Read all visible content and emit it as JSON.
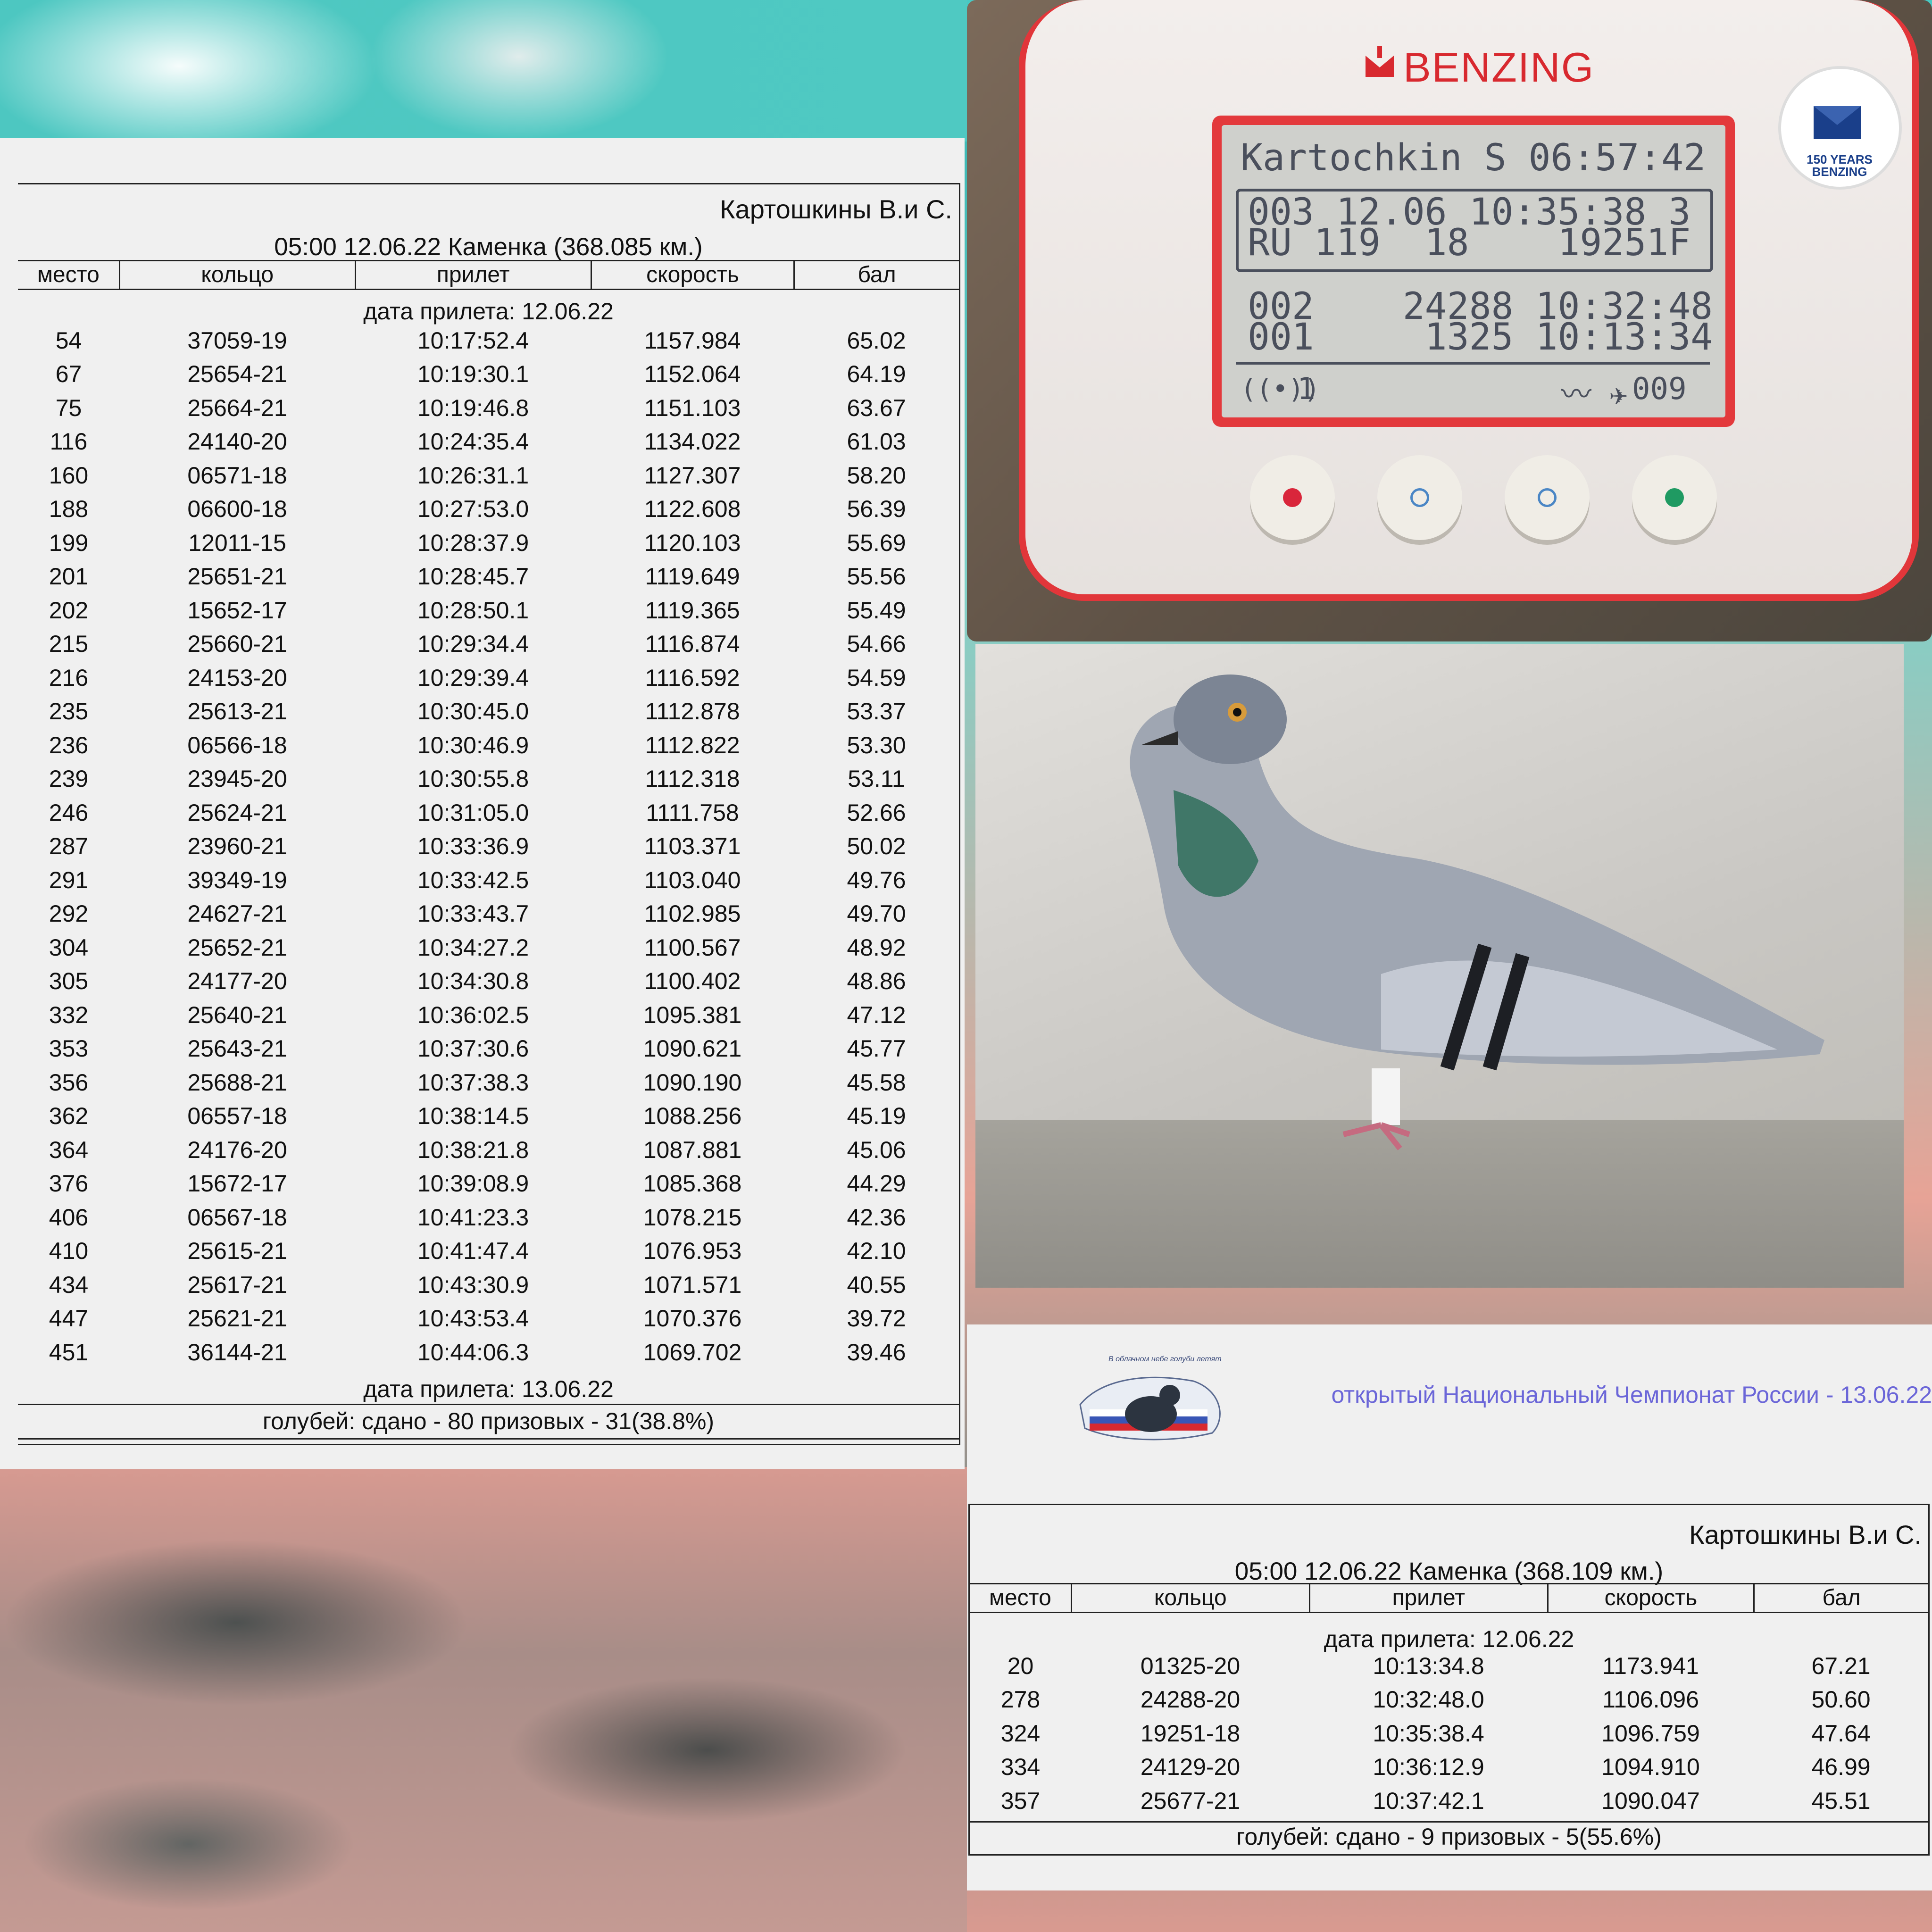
{
  "table_left": {
    "owner": "Картошкины В.и С.",
    "race": "05:00 12.06.22 Каменка (368.085 км.)",
    "headers": [
      "место",
      "кольцо",
      "прилет",
      "скорость",
      "бал"
    ],
    "date1": "дата прилета: 12.06.22",
    "rows": [
      [
        "54",
        "37059-19",
        "10:17:52.4",
        "1157.984",
        "65.02"
      ],
      [
        "67",
        "25654-21",
        "10:19:30.1",
        "1152.064",
        "64.19"
      ],
      [
        "75",
        "25664-21",
        "10:19:46.8",
        "1151.103",
        "63.67"
      ],
      [
        "116",
        "24140-20",
        "10:24:35.4",
        "1134.022",
        "61.03"
      ],
      [
        "160",
        "06571-18",
        "10:26:31.1",
        "1127.307",
        "58.20"
      ],
      [
        "188",
        "06600-18",
        "10:27:53.0",
        "1122.608",
        "56.39"
      ],
      [
        "199",
        "12011-15",
        "10:28:37.9",
        "1120.103",
        "55.69"
      ],
      [
        "201",
        "25651-21",
        "10:28:45.7",
        "1119.649",
        "55.56"
      ],
      [
        "202",
        "15652-17",
        "10:28:50.1",
        "1119.365",
        "55.49"
      ],
      [
        "215",
        "25660-21",
        "10:29:34.4",
        "1116.874",
        "54.66"
      ],
      [
        "216",
        "24153-20",
        "10:29:39.4",
        "1116.592",
        "54.59"
      ],
      [
        "235",
        "25613-21",
        "10:30:45.0",
        "1112.878",
        "53.37"
      ],
      [
        "236",
        "06566-18",
        "10:30:46.9",
        "1112.822",
        "53.30"
      ],
      [
        "239",
        "23945-20",
        "10:30:55.8",
        "1112.318",
        "53.11"
      ],
      [
        "246",
        "25624-21",
        "10:31:05.0",
        "1111.758",
        "52.66"
      ],
      [
        "287",
        "23960-21",
        "10:33:36.9",
        "1103.371",
        "50.02"
      ],
      [
        "291",
        "39349-19",
        "10:33:42.5",
        "1103.040",
        "49.76"
      ],
      [
        "292",
        "24627-21",
        "10:33:43.7",
        "1102.985",
        "49.70"
      ],
      [
        "304",
        "25652-21",
        "10:34:27.2",
        "1100.567",
        "48.92"
      ],
      [
        "305",
        "24177-20",
        "10:34:30.8",
        "1100.402",
        "48.86"
      ],
      [
        "332",
        "25640-21",
        "10:36:02.5",
        "1095.381",
        "47.12"
      ],
      [
        "353",
        "25643-21",
        "10:37:30.6",
        "1090.621",
        "45.77"
      ],
      [
        "356",
        "25688-21",
        "10:37:38.3",
        "1090.190",
        "45.58"
      ],
      [
        "362",
        "06557-18",
        "10:38:14.5",
        "1088.256",
        "45.19"
      ],
      [
        "364",
        "24176-20",
        "10:38:21.8",
        "1087.881",
        "45.06"
      ],
      [
        "376",
        "15672-17",
        "10:39:08.9",
        "1085.368",
        "44.29"
      ],
      [
        "406",
        "06567-18",
        "10:41:23.3",
        "1078.215",
        "42.36"
      ],
      [
        "410",
        "25615-21",
        "10:41:47.4",
        "1076.953",
        "42.10"
      ],
      [
        "434",
        "25617-21",
        "10:43:30.9",
        "1071.571",
        "40.55"
      ],
      [
        "447",
        "25621-21",
        "10:43:53.4",
        "1070.376",
        "39.72"
      ],
      [
        "451",
        "36144-21",
        "10:44:06.3",
        "1069.702",
        "39.46"
      ]
    ],
    "date2": "дата прилета: 13.06.22",
    "summary": "голубей: сдано - 80 призовых - 31(38.8%)"
  },
  "table_right": {
    "owner": "Картошкины В.и С.",
    "race": "05:00 12.06.22 Каменка (368.109 км.)",
    "headers": [
      "место",
      "кольцо",
      "прилет",
      "скорость",
      "бал"
    ],
    "date1": "дата прилета: 12.06.22",
    "rows": [
      [
        "20",
        "01325-20",
        "10:13:34.8",
        "1173.941",
        "67.21"
      ],
      [
        "278",
        "24288-20",
        "10:32:48.0",
        "1106.096",
        "50.60"
      ],
      [
        "324",
        "19251-18",
        "10:35:38.4",
        "1096.759",
        "47.64"
      ],
      [
        "334",
        "24129-20",
        "10:36:12.9",
        "1094.910",
        "46.99"
      ],
      [
        "357",
        "25677-21",
        "10:37:42.1",
        "1090.047",
        "45.51"
      ]
    ],
    "summary": "голубей: сдано - 9 призовых - 5(55.6%)"
  },
  "device": {
    "brand": "BENZING",
    "badge_text": "150 YEARS BENZING",
    "lcd_line1": "Kartochkin S 06:57:42",
    "lcd_line2": "003 12.06 10:35:38 3",
    "lcd_line3": "RU 119  18    19251F",
    "lcd_line4": "002    24288 10:32:48",
    "lcd_line5": "001     1325 10:13:34",
    "lcd_status_left": "1",
    "lcd_status_right": "009",
    "button_dot_colors": [
      "#d9263b",
      "#4a86c5",
      "#4a86c5",
      "#1f9a62"
    ]
  },
  "championship": "открытый Национальный Чемпионат России - 13.06.22",
  "logo_text": "В облачном небе голуби летят"
}
